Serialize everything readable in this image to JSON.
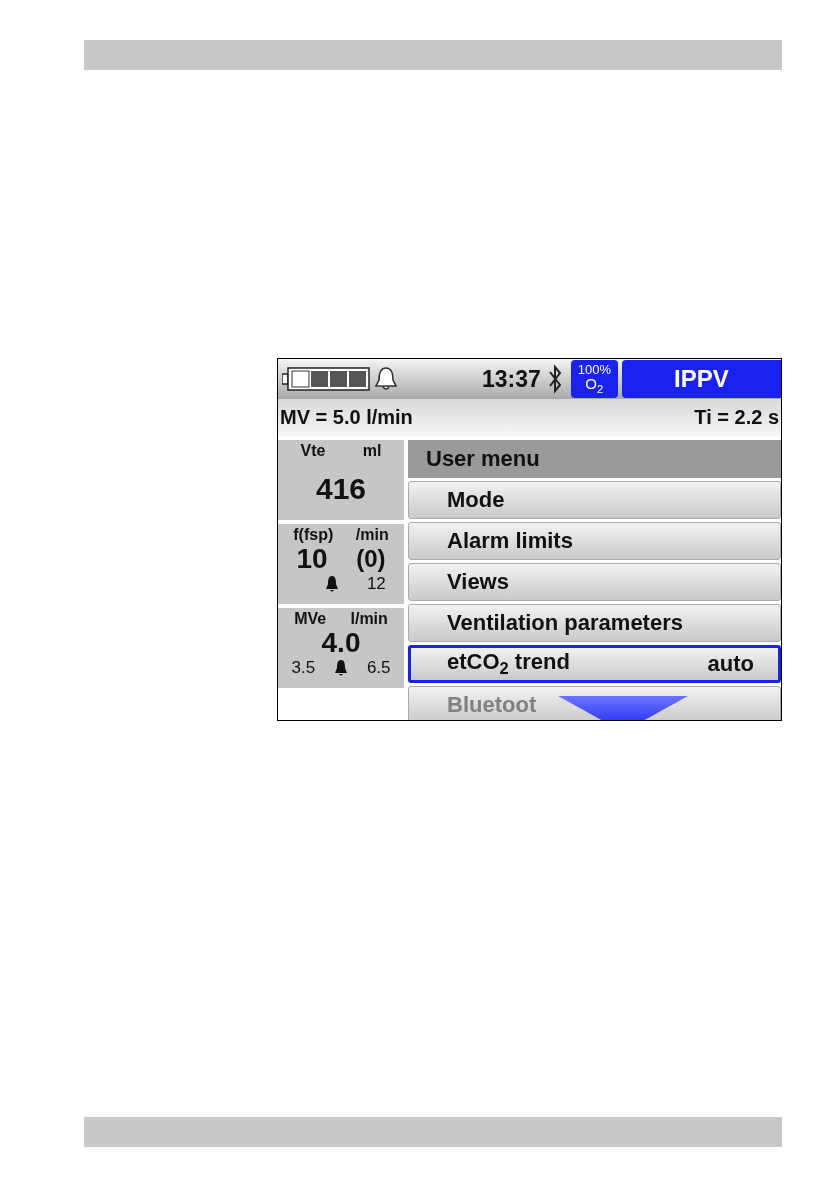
{
  "status_bar": {
    "time": "13:37",
    "oxygen": {
      "percent": "100%",
      "gas": "O$_{2}$"
    },
    "mode": "IPPV"
  },
  "settings_bar": {
    "minute_volume": "MV = 5.0 l/min",
    "inspiration_time": "Ti = 2.2 s"
  },
  "tiles": [
    {
      "label": "Vte",
      "unit": "ml",
      "value": "416"
    },
    {
      "label": "f(fsp)",
      "unit": "/min",
      "value": "10",
      "spontaneous": "(0)",
      "alarm_high": "12"
    },
    {
      "label": "MVe",
      "unit": "l/min",
      "value": "4.0",
      "alarm_low": "3.5",
      "alarm_high": "6.5"
    }
  ],
  "menu": {
    "title": "User menu",
    "items": [
      {
        "label": "Mode",
        "selected": false,
        "disabled": false
      },
      {
        "label": "Alarm limits",
        "selected": false,
        "disabled": false
      },
      {
        "label": "Views",
        "selected": false,
        "disabled": false
      },
      {
        "label": "Ventilation parameters",
        "selected": false,
        "disabled": false
      },
      {
        "label": "etCO$_{2}$ trend",
        "value": "auto",
        "selected": true,
        "disabled": false
      },
      {
        "label": "Bluetoot",
        "selected": false,
        "disabled": true
      }
    ]
  }
}
